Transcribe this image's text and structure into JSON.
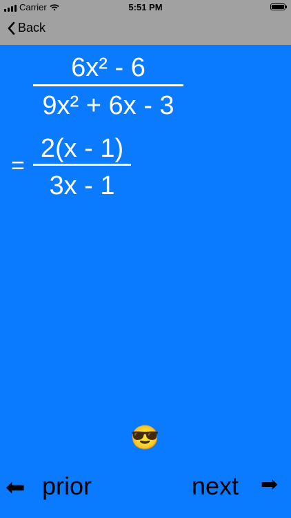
{
  "status": {
    "carrier": "Carrier",
    "time": "5:51 PM"
  },
  "nav": {
    "back_label": "Back"
  },
  "expression": {
    "original_numerator": "6x² - 6",
    "original_denominator": "9x² + 6x - 3",
    "equals": "=",
    "simplified_numerator": "2(x - 1)",
    "simplified_denominator": "3x - 1"
  },
  "feedback": {
    "emoji": "😎"
  },
  "footer": {
    "left_arrow": "⬅",
    "prior_label": "prior",
    "next_label": "next",
    "right_arrow": "➡"
  },
  "colors": {
    "background": "#0a7bff",
    "header": "#a1a1a1",
    "text": "#ffffff"
  }
}
